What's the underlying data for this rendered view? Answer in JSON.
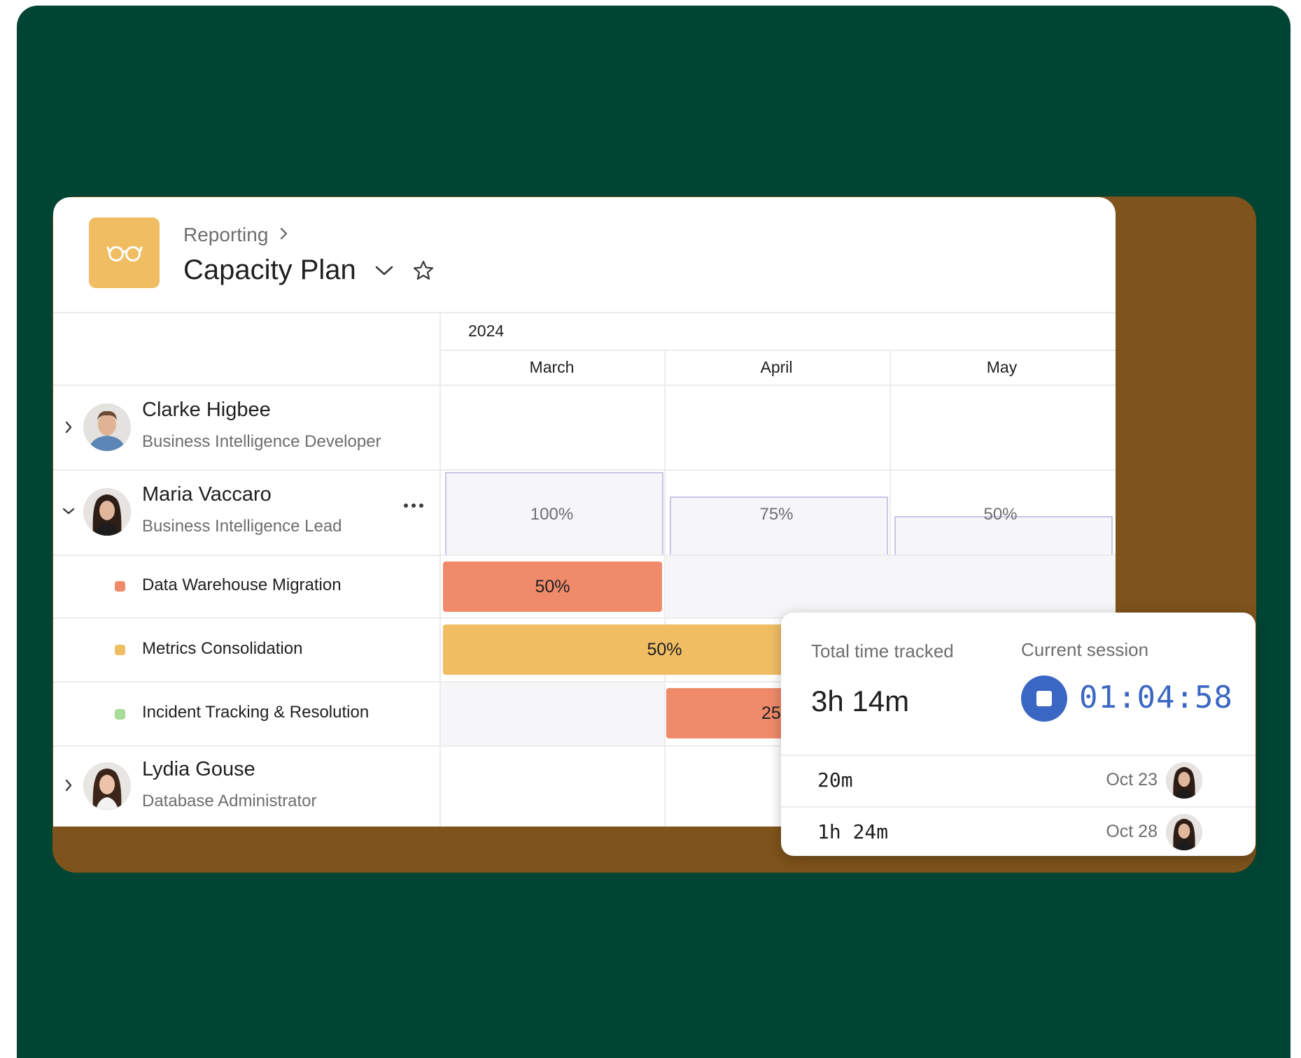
{
  "header": {
    "breadcrumb": "Reporting",
    "title": "Capacity Plan",
    "icon": "glasses-icon"
  },
  "timeline": {
    "year": "2024",
    "months": [
      "March",
      "April",
      "May"
    ]
  },
  "people": [
    {
      "name": "Clarke Higbee",
      "role": "Business Intelligence Developer",
      "expanded": false
    },
    {
      "name": "Maria Vaccaro",
      "role": "Business Intelligence Lead",
      "expanded": true,
      "capacity": [
        "100%",
        "75%",
        "50%"
      ]
    },
    {
      "name": "Lydia Gouse",
      "role": "Database Administrator",
      "expanded": false
    }
  ],
  "tasks": [
    {
      "name": "Data Warehouse Migration",
      "color": "#ef8a6a",
      "allocation": "50%"
    },
    {
      "name": "Metrics Consolidation",
      "color": "#f0bd63",
      "allocation": "50%"
    },
    {
      "name": "Incident Tracking & Resolution",
      "color": "#a7dc96",
      "allocation": "25"
    }
  ],
  "time_tracking": {
    "total_label": "Total time tracked",
    "total_value": "3h 14m",
    "session_label": "Current session",
    "session_value": "01:04:58",
    "entries": [
      {
        "duration": "20m",
        "date": "Oct 23"
      },
      {
        "duration": "1h 24m",
        "date": "Oct 28"
      }
    ]
  },
  "colors": {
    "background": "#004433",
    "accent_panel": "#7e531c",
    "project_icon": "#f0bd63",
    "timer": "#3b67c4"
  }
}
